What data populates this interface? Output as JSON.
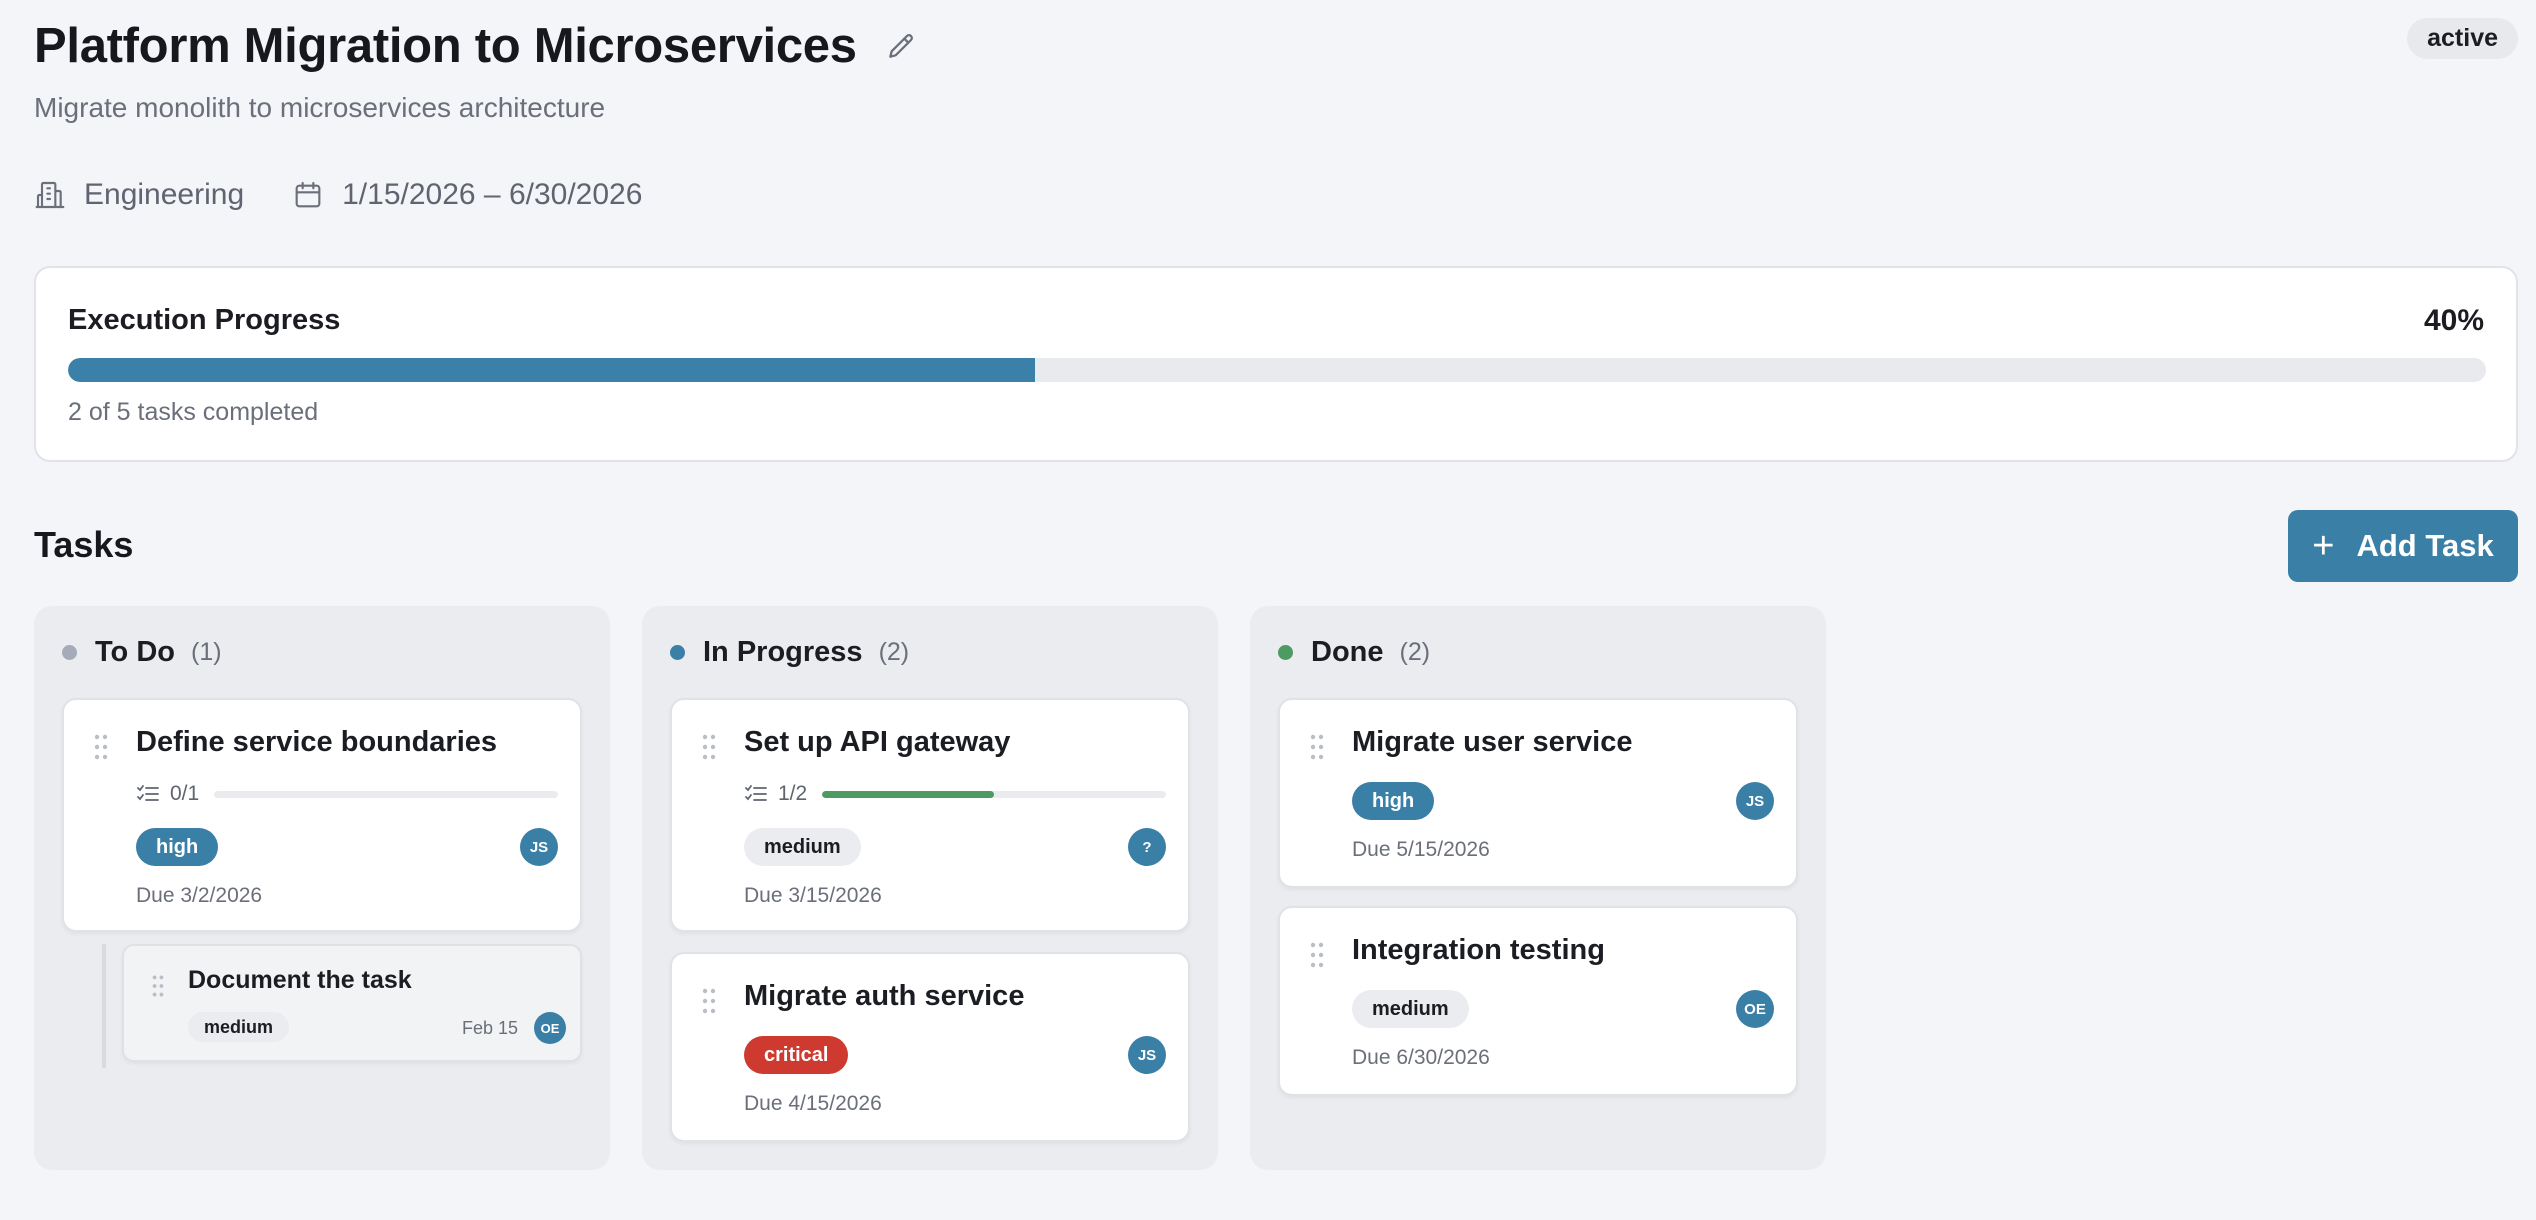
{
  "project": {
    "title": "Platform Migration to Microservices",
    "subtitle": "Migrate monolith to microservices architecture",
    "status": "active",
    "department": "Engineering",
    "date_range": "1/15/2026 – 6/30/2026"
  },
  "progress": {
    "label": "Execution Progress",
    "percent_text": "40%",
    "percent": 40,
    "summary": "2 of 5 tasks completed"
  },
  "tasks_section": {
    "title": "Tasks",
    "add_button_label": "Add Task"
  },
  "colors": {
    "accent": "#3a7fa6",
    "critical": "#cf3a30",
    "done": "#4e9a63",
    "todo": "#a5abb8"
  },
  "columns": [
    {
      "name": "To Do",
      "count": "(1)",
      "dot_color": "#a5abb8",
      "cards": [
        {
          "title": "Define service boundaries",
          "checklist": "0/1",
          "checklist_progress": 0,
          "priority": "high",
          "assignee": "JS",
          "due": "Due 3/2/2026",
          "subtasks": [
            {
              "title": "Document the task",
              "priority": "medium",
              "date": "Feb 15",
              "assignee": "OE"
            }
          ]
        }
      ]
    },
    {
      "name": "In Progress",
      "count": "(2)",
      "dot_color": "#3a7fa6",
      "cards": [
        {
          "title": "Set up API gateway",
          "checklist": "1/2",
          "checklist_progress": 0.5,
          "priority": "medium",
          "assignee": "?",
          "due": "Due 3/15/2026"
        },
        {
          "title": "Migrate auth service",
          "priority": "critical",
          "assignee": "JS",
          "due": "Due 4/15/2026"
        }
      ]
    },
    {
      "name": "Done",
      "count": "(2)",
      "dot_color": "#4e9a63",
      "cards": [
        {
          "title": "Migrate user service",
          "priority": "high",
          "assignee": "JS",
          "due": "Due 5/15/2026"
        },
        {
          "title": "Integration testing",
          "priority": "medium",
          "assignee": "OE",
          "due": "Due 6/30/2026"
        }
      ]
    }
  ],
  "icons": {
    "edit": "pencil-icon",
    "department": "building-icon",
    "dates": "calendar-icon",
    "checklist": "checklist-icon",
    "drag": "grip-vertical-icon",
    "add": "plus-icon"
  }
}
